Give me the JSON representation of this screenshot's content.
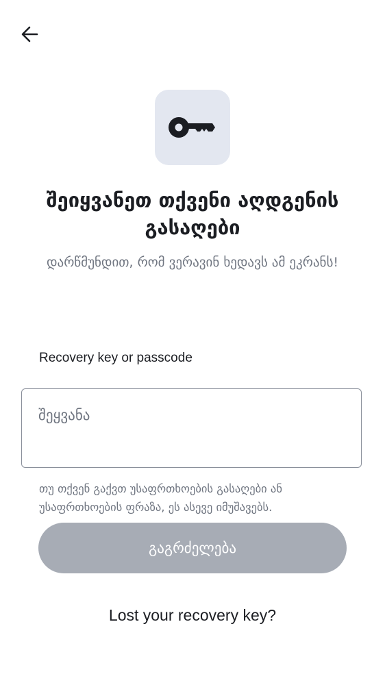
{
  "header": {
    "back_icon": "arrow-left-icon"
  },
  "hero": {
    "icon": "key-icon",
    "icon_bg_color": "#e3e7f0"
  },
  "title": "შეიყვანეთ თქვენი აღდგენის გასაღები",
  "subtitle": "დარწმუნდით, რომ ვერავინ ხედავს ამ ეკრანს!",
  "form": {
    "label": "Recovery key or passcode",
    "placeholder": "შეყვანა",
    "value": "",
    "hint": "თუ თქვენ გაქვთ უსაფრთხოების გასაღები ან უსაფრთხოების ფრაზა, ეს ასევე იმუშავებს."
  },
  "continue_button": {
    "label": "გაგრძელება",
    "enabled": false,
    "color": "#a7acb5"
  },
  "lost_key_link": "Lost your recovery key?"
}
